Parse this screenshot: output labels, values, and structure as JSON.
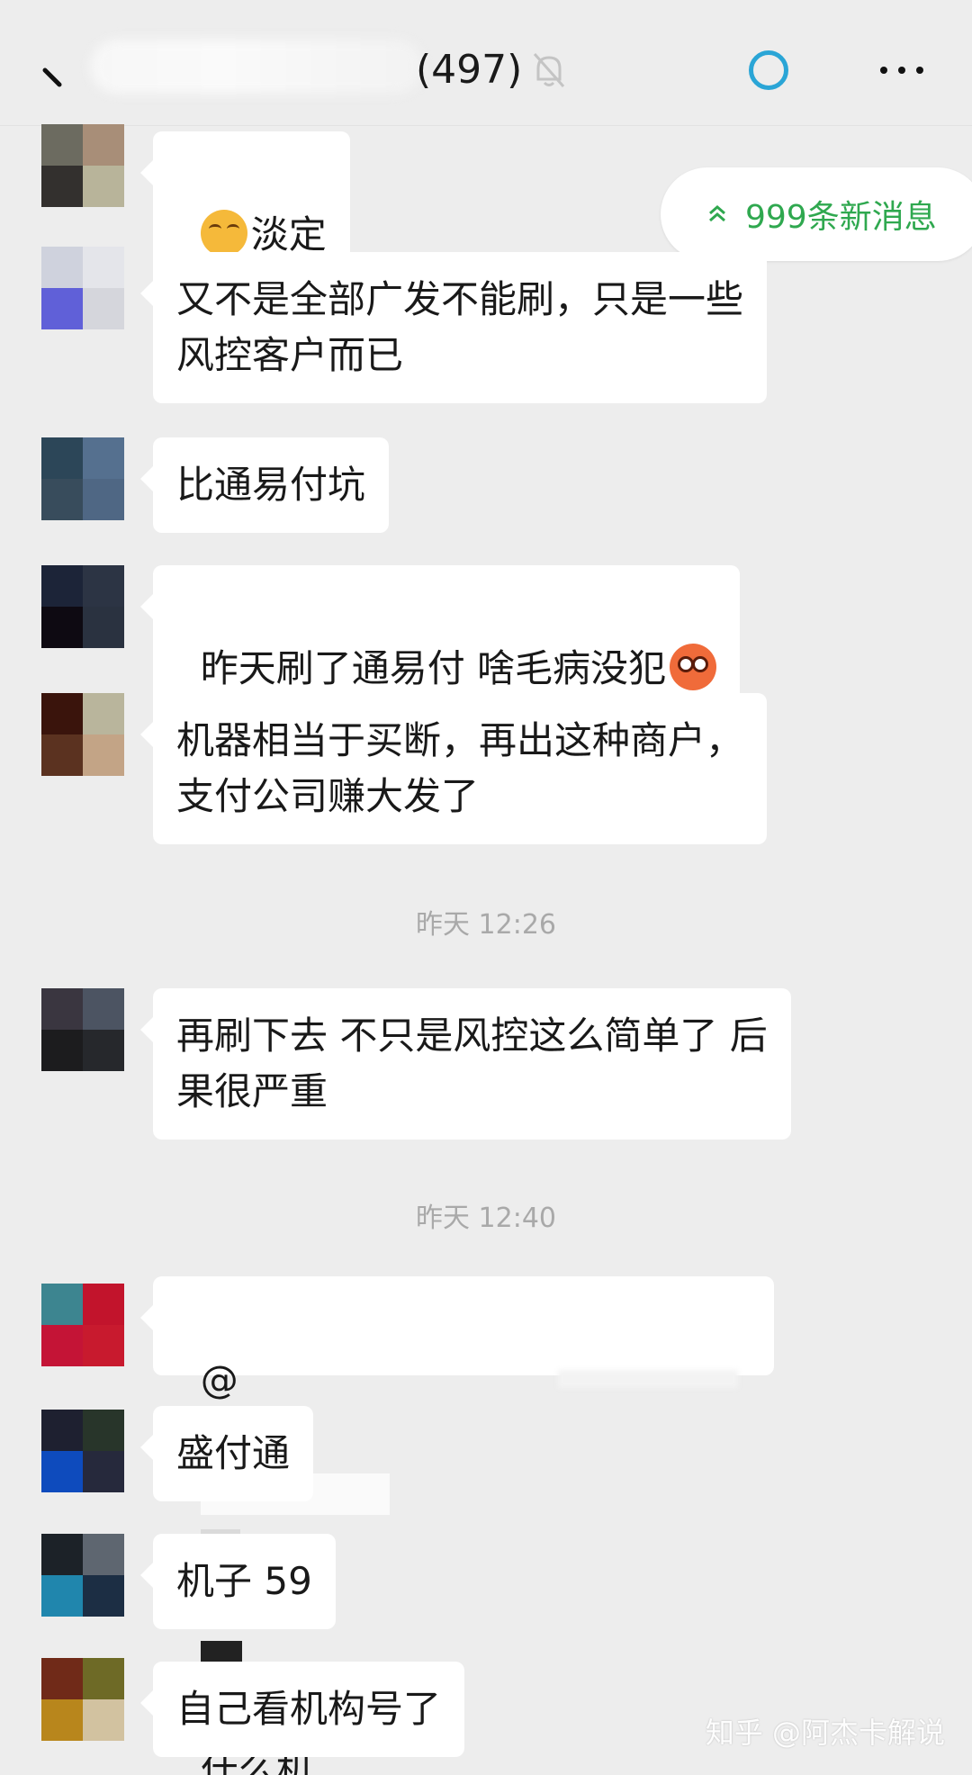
{
  "header": {
    "title_count": "(497)"
  },
  "new_messages": {
    "label": "999条新消息"
  },
  "messages": [
    {
      "text": "淡定"
    },
    {
      "text": "又不是全部广发不能刷，只是一些\n风控客户而已"
    },
    {
      "text": "比通易付坑"
    },
    {
      "text": "昨天刷了通易付 啥毛病没犯"
    },
    {
      "text": "机器相当于买断，再出这种商户，\n支付公司赚大发了"
    },
    {
      "text": "再刷下去 不只是风控这么简单了 后\n果很严重"
    },
    {
      "text_prefix": "@",
      "text_suffix": "什么机"
    },
    {
      "text": "盛付通"
    },
    {
      "text": "机子 59"
    },
    {
      "text": "自己看机构号了"
    }
  ],
  "timestamps": {
    "t1": "昨天 12:26",
    "t2": "昨天 12:40"
  },
  "watermark": "知乎 @阿杰卡解说",
  "colors": {
    "accent_green": "#2fa84f",
    "status_blue": "#2aa5d6",
    "background": "#ededed",
    "bubble": "#ffffff"
  },
  "icons": {
    "back": "back-arrow-icon",
    "mute": "muted-bell-icon",
    "status": "loading-circle-icon",
    "more": "more-dots-icon",
    "new_msg": "double-chevron-up-icon"
  }
}
